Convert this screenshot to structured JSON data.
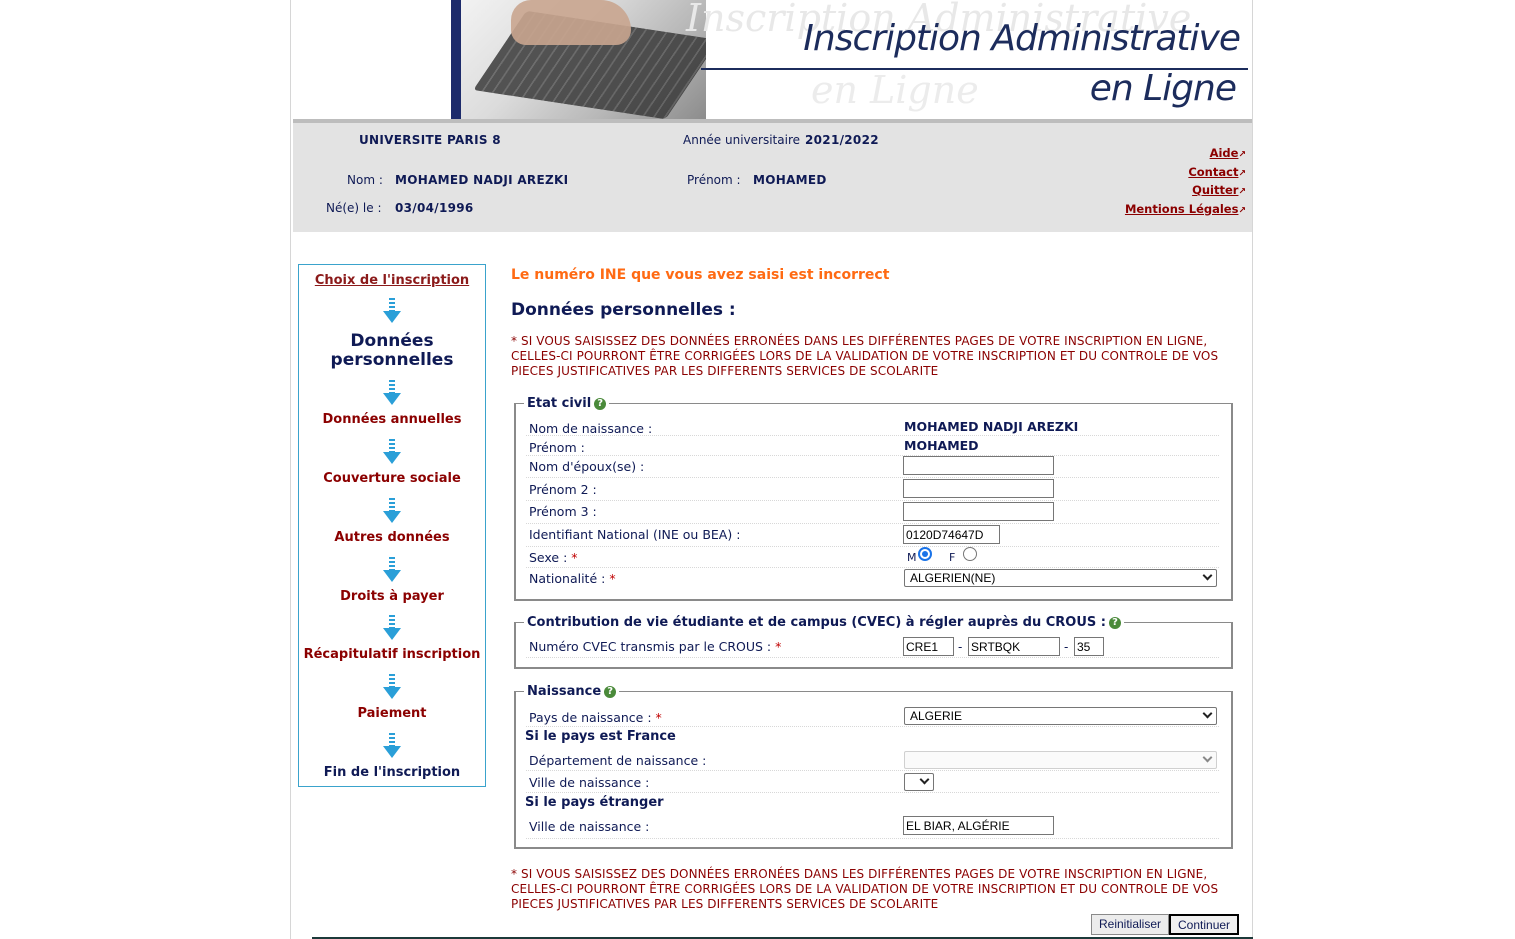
{
  "banner": {
    "title_line1": "Inscription Administrative",
    "title_line2": "en Ligne"
  },
  "header": {
    "university": "UNIVERSITE PARIS 8",
    "year_label": "Année universitaire",
    "year_value": "2021/2022",
    "nom_label": "Nom :",
    "nom_value": "MOHAMED NADJI AREZKI",
    "prenom_label": "Prénom :",
    "prenom_value": "MOHAMED",
    "ne_label": "Né(e) le :",
    "ne_value": "03/04/1996",
    "links": {
      "aide": "Aide",
      "contact": "Contact",
      "quitter": "Quitter",
      "mentions": "Mentions Légales"
    },
    "link_icon": "external-link-icon"
  },
  "nav": {
    "choix": "Choix de l'inscription",
    "donnees_perso": "Données personnelles",
    "donnees_annuelles": "Données annuelles",
    "couverture": "Couverture sociale",
    "autres": "Autres données",
    "droits": "Droits à payer",
    "recap": "Récapitulatif inscription",
    "paiement": "Paiement",
    "fin": "Fin de l'inscription"
  },
  "main": {
    "error": "Le numéro INE que vous avez saisi est incorrect",
    "title": "Données personnelles :",
    "warning_line1": "* SI VOUS SAISISSEZ DES DONNÉES ERRONÉES DANS LES DIFFÉRENTES PAGES DE VOTRE INSCRIPTION EN LIGNE,",
    "warning_line2": "CELLES-CI POURRONT ÊTRE CORRIGÉES LORS DE LA VALIDATION DE VOTRE INSCRIPTION ET DU CONTROLE DE VOS",
    "warning_line3": "PIECES JUSTIFICATIVES PAR LES DIFFERENTS SERVICES DE SCOLARITE"
  },
  "etat_civil": {
    "legend": "Etat civil",
    "nom_naissance_label": "Nom de naissance :",
    "nom_naissance_value": "MOHAMED NADJI AREZKI",
    "prenom_label": "Prénom :",
    "prenom_value": "MOHAMED",
    "nom_epoux_label": "Nom d'époux(se) :",
    "nom_epoux_value": "",
    "prenom2_label": "Prénom 2 :",
    "prenom2_value": "",
    "prenom3_label": "Prénom 3 :",
    "prenom3_value": "",
    "ine_label": "Identifiant National (INE ou BEA) :",
    "ine_value": "0120D74647D",
    "sexe_label": "Sexe :",
    "sexe_m": "M",
    "sexe_f": "F",
    "sexe_selected": "M",
    "nationalite_label": "Nationalité :",
    "nationalite_value": "ALGERIEN(NE)"
  },
  "cvec": {
    "legend": "Contribution de vie étudiante et de campus (CVEC) à régler auprès du CROUS :",
    "label": "Numéro CVEC transmis par le CROUS :",
    "part1": "CRE1",
    "part2": "SRTBQK",
    "part3": "35",
    "sep": "-"
  },
  "naissance": {
    "legend": "Naissance",
    "pays_label": "Pays de naissance :",
    "pays_value": "ALGERIE",
    "si_france": "Si le pays est France",
    "dept_label": "Département de naissance :",
    "dept_value": "",
    "ville_fr_label": "Ville de naissance :",
    "ville_fr_value": "",
    "si_etranger": "Si le pays étranger",
    "ville_etr_label": "Ville de naissance :",
    "ville_etr_value": "EL BIAR, ALGÉRIE"
  },
  "buttons": {
    "reset": "Reinitialiser",
    "continue": "Continuer"
  },
  "colors": {
    "navy": "#0f1a55",
    "darkred": "#8b0000",
    "orange": "#ff6a13",
    "nav_border": "#3aa3cc",
    "help_icon": "#4a8a3a"
  }
}
